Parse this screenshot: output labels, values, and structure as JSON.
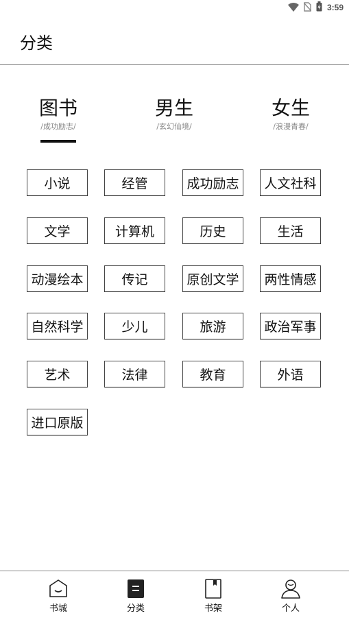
{
  "status_bar": {
    "time": "3:59",
    "icons": [
      "wifi-icon",
      "no-sim-icon",
      "battery-charging-icon"
    ]
  },
  "header": {
    "title": "分类"
  },
  "tabs": [
    {
      "title": "图书",
      "subtitle": "/成功励志/",
      "active": true
    },
    {
      "title": "男生",
      "subtitle": "/玄幻仙境/",
      "active": false
    },
    {
      "title": "女生",
      "subtitle": "/浪漫青春/",
      "active": false
    }
  ],
  "categories": [
    "小说",
    "经管",
    "成功励志",
    "人文社科",
    "文学",
    "计算机",
    "历史",
    "生活",
    "动漫绘本",
    "传记",
    "原创文学",
    "两性情感",
    "自然科学",
    "少儿",
    "旅游",
    "政治军事",
    "艺术",
    "法律",
    "教育",
    "外语",
    "进口原版"
  ],
  "bottom_nav": [
    {
      "label": "书城",
      "icon": "bookstore-icon",
      "active": false
    },
    {
      "label": "分类",
      "icon": "category-icon",
      "active": true
    },
    {
      "label": "书架",
      "icon": "bookshelf-icon",
      "active": false
    },
    {
      "label": "个人",
      "icon": "profile-icon",
      "active": false
    }
  ],
  "colors": {
    "text": "#111111",
    "subtext": "#888888",
    "border": "#444444",
    "background": "#ffffff"
  }
}
